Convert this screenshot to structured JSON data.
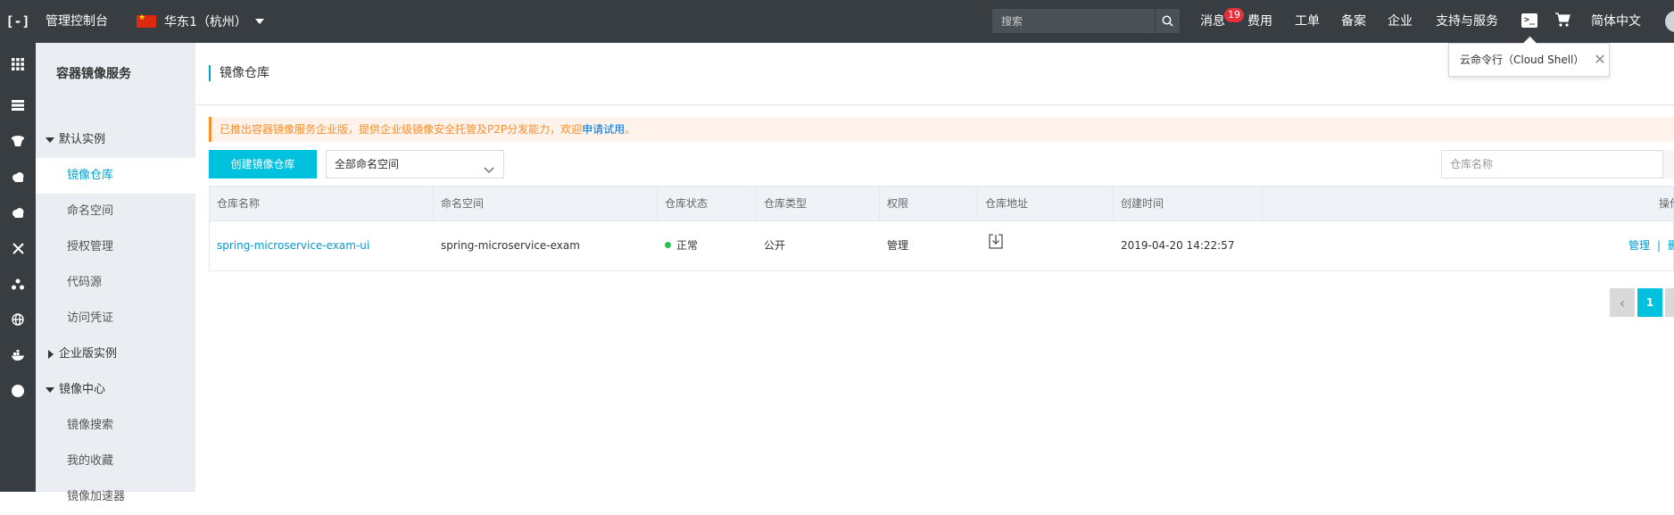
{
  "topbar": {
    "logo": "[-]",
    "console_title": "管理控制台",
    "region": "华东1（杭州）",
    "search_placeholder": "搜索",
    "nav": {
      "messages": "消息",
      "messages_badge": "19",
      "billing": "费用",
      "tickets": "工单",
      "icp": "备案",
      "enterprise": "企业",
      "support": "支持与服务",
      "language": "简体中文"
    },
    "terminal_glyph": ">_"
  },
  "cloud_shell_tip": {
    "label": "云命令行（Cloud Shell）",
    "close": "✕"
  },
  "sidebar": {
    "title": "容器镜像服务",
    "groups": {
      "default_instance": "默认实例",
      "enterprise_instance": "企业版实例",
      "image_center": "镜像中心"
    },
    "items": {
      "repos": "镜像仓库",
      "namespaces": "命名空间",
      "authorization": "授权管理",
      "code_source": "代码源",
      "credentials": "访问凭证",
      "image_search": "镜像搜索",
      "favorites": "我的收藏",
      "accelerator": "镜像加速器"
    }
  },
  "main": {
    "title": "镜像仓库",
    "notice": {
      "text": "已推出容器镜像服务企业版，提供企业级镜像安全托管及P2P分发能力，欢迎",
      "link": "申请试用",
      "suffix": "。"
    },
    "create_button": "创建镜像仓库",
    "namespace_select": "全部命名空间",
    "repo_search_placeholder": "仓库名称",
    "table": {
      "headers": {
        "name": "仓库名称",
        "namespace": "命名空间",
        "status": "仓库状态",
        "type": "仓库类型",
        "permission": "权限",
        "address": "仓库地址",
        "created": "创建时间",
        "actions": "操作"
      },
      "rows": [
        {
          "name": "spring-microservice-exam-ui",
          "namespace": "spring-microservice-exam",
          "status": "正常",
          "type": "公开",
          "permission": "管理",
          "created": "2019-04-20 14:22:57",
          "action_manage": "管理",
          "action_sep": "|",
          "action_delete": "删除"
        }
      ]
    },
    "pagination": {
      "prev": "‹",
      "current": "1"
    }
  },
  "colors": {
    "topbar_bg": "#373d41",
    "accent": "#00c1de",
    "link": "#0099cc",
    "status_ok": "#1fc64c",
    "notice_text": "#f98e2b"
  }
}
